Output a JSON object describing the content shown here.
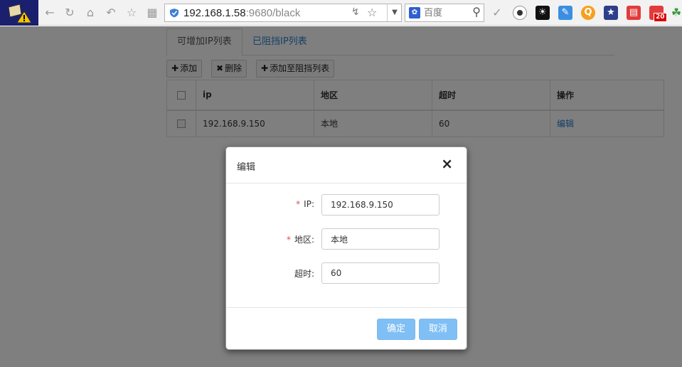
{
  "browser": {
    "url_host": "192.168.1.58",
    "url_rest": ":9680/black",
    "search_placeholder": "百度",
    "badge_count": "20",
    "accent_color": "#2a7fcf"
  },
  "tabs": [
    {
      "label": "可增加IP列表",
      "active": true
    },
    {
      "label": "已阻挡IP列表",
      "active": false
    }
  ],
  "toolbar": {
    "add_label": "添加",
    "delete_label": "删除",
    "add_block_label": "添加至阻挡列表"
  },
  "table": {
    "headers": [
      "ip",
      "地区",
      "超时",
      "操作"
    ],
    "rows": [
      {
        "ip": "192.168.9.150",
        "region": "本地",
        "timeout": "60",
        "action": "编辑"
      }
    ]
  },
  "modal": {
    "title": "编辑",
    "close": "×",
    "fields": [
      {
        "label": "IP:",
        "required": true,
        "value": "192.168.9.150"
      },
      {
        "label": "地区:",
        "required": true,
        "value": "本地"
      },
      {
        "label": "超时:",
        "required": false,
        "value": "60"
      }
    ],
    "required_mark": "*",
    "confirm_label": "确定",
    "cancel_label": "取消"
  }
}
